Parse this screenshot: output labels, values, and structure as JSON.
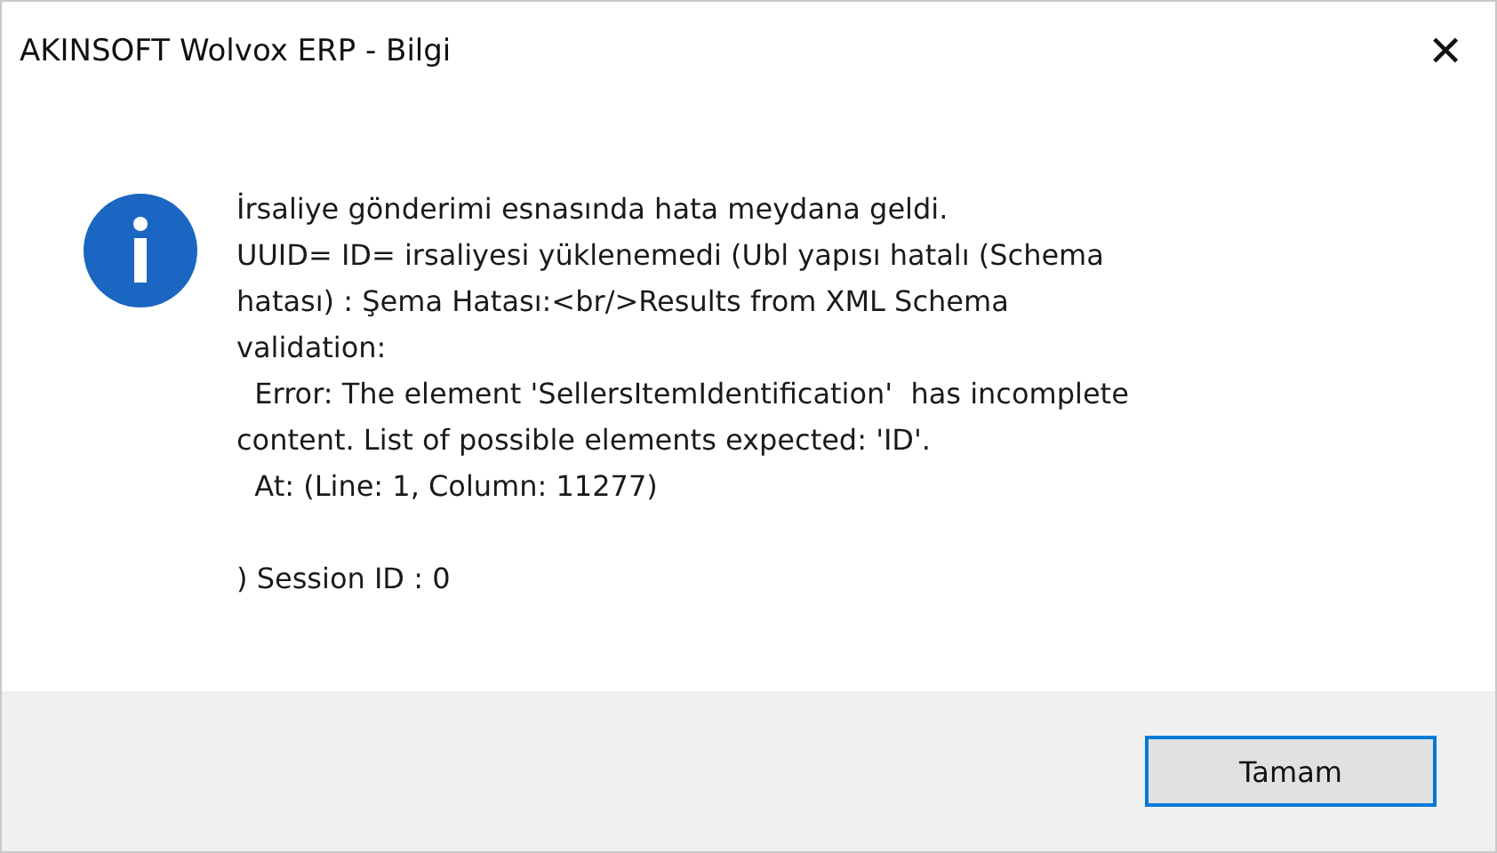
{
  "window": {
    "title": "AKINSOFT Wolvox ERP - Bilgi",
    "close": "✕"
  },
  "message": {
    "paragraphs": [
      [
        "İrsaliye gönderimi esnasında hata meydana geldi.",
        "UUID= ID= irsaliyesi yüklenemedi (Ubl yapısı hatalı (Schema",
        "hatası) : Şema Hatası:<br/>Results from XML Schema",
        "validation:",
        "  Error: The element 'SellersItemIdentification'  has incomplete",
        "content. List of possible elements expected: 'ID'.",
        "  At: (Line: 1, Column: 11277)"
      ],
      [
        ") Session ID : 0"
      ]
    ]
  },
  "buttons": [
    {
      "label": "Tamam",
      "default": true
    }
  ]
}
